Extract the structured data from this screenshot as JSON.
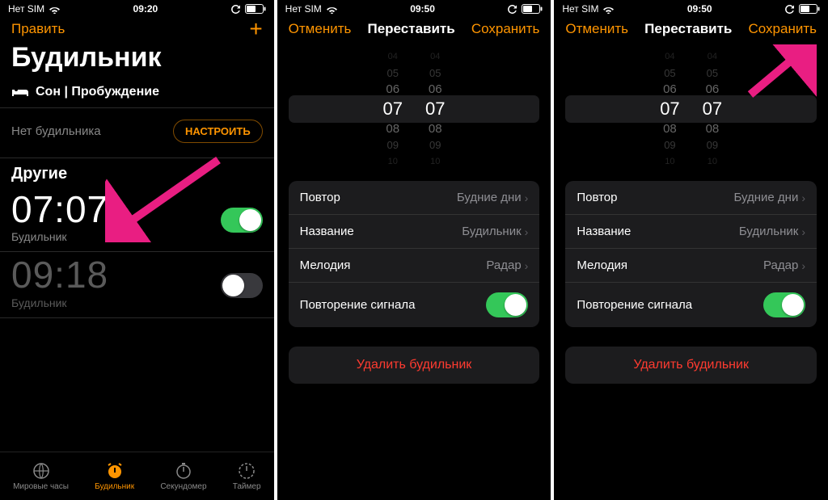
{
  "status": {
    "carrier": "Нет SIM",
    "time1": "09:20",
    "time23": "09:50"
  },
  "screen1": {
    "edit": "Править",
    "title": "Будильник",
    "sleep_section": "Сон | Пробуждение",
    "no_alarm": "Нет будильника",
    "setup": "НАСТРОИТЬ",
    "other": "Другие",
    "alarms": [
      {
        "time": "07:07",
        "label": "Будильник",
        "on": true
      },
      {
        "time": "09:18",
        "label": "Будильник",
        "on": false
      }
    ],
    "tabs": {
      "world": "Мировые часы",
      "alarm": "Будильник",
      "stopwatch": "Секундомер",
      "timer": "Таймер"
    }
  },
  "editScreen": {
    "cancel": "Отменить",
    "title": "Переставить",
    "save": "Сохранить",
    "picker": {
      "hours": [
        "04",
        "05",
        "06",
        "07",
        "08",
        "09",
        "10"
      ],
      "minutes": [
        "04",
        "05",
        "06",
        "07",
        "08",
        "09",
        "10"
      ],
      "selected_hour": "07",
      "selected_minute": "07"
    },
    "rows": {
      "repeat_label": "Повтор",
      "repeat_value": "Будние дни",
      "name_label": "Название",
      "name_value": "Будильник",
      "sound_label": "Мелодия",
      "sound_value": "Радар",
      "snooze_label": "Повторение сигнала"
    },
    "delete": "Удалить будильник"
  },
  "colors": {
    "accent": "#ff9500",
    "green": "#34c759",
    "red": "#ff3b30"
  }
}
